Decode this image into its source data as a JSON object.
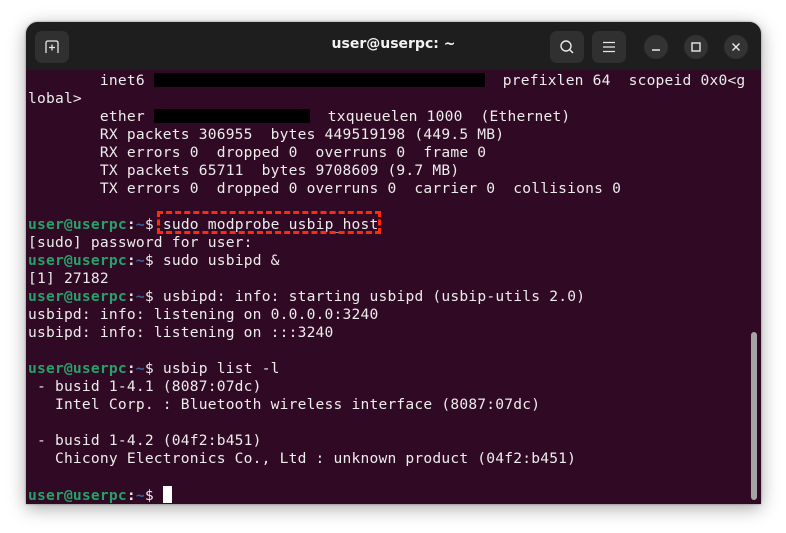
{
  "window": {
    "title": "user@userpc: ~",
    "buttons": {
      "new_tab_icon": "new-tab-icon",
      "search_icon": "search-icon",
      "menu_icon": "hamburger-menu-icon",
      "minimize_icon": "minimize-icon",
      "maximize_icon": "maximize-icon",
      "close_icon": "close-icon"
    }
  },
  "prompt": {
    "user_host": "user@userpc",
    "colon": ":",
    "path": "~",
    "symbol": "$ "
  },
  "terminal": {
    "lines": [
      {
        "type": "redacted",
        "pre": "        inet6 ",
        "post": "  prefixlen 64  scopeid 0x0<g"
      },
      {
        "type": "output",
        "text": "lobal>"
      },
      {
        "type": "redacted2",
        "pre": "        ether ",
        "post": "  txqueuelen 1000  (Ethernet)"
      },
      {
        "type": "output",
        "text": "        RX packets 306955  bytes 449519198 (449.5 MB)"
      },
      {
        "type": "output",
        "text": "        RX errors 0  dropped 0  overruns 0  frame 0"
      },
      {
        "type": "output",
        "text": "        TX packets 65711  bytes 9708609 (9.7 MB)"
      },
      {
        "type": "output",
        "text": "        TX errors 0  dropped 0 overruns 0  carrier 0  collisions 0"
      },
      {
        "type": "output",
        "text": ""
      },
      {
        "type": "command",
        "text": "sudo modprobe usbip_host"
      },
      {
        "type": "output",
        "text": "[sudo] password for user:"
      },
      {
        "type": "command",
        "text": "sudo usbipd &"
      },
      {
        "type": "output",
        "text": "[1] 27182"
      },
      {
        "type": "command",
        "text": "usbipd: info: starting usbipd (usbip-utils 2.0)"
      },
      {
        "type": "output",
        "text": "usbipd: info: listening on 0.0.0.0:3240"
      },
      {
        "type": "output",
        "text": "usbipd: info: listening on :::3240"
      },
      {
        "type": "output",
        "text": ""
      },
      {
        "type": "command",
        "text": "usbip list -l"
      },
      {
        "type": "output",
        "text": " - busid 1-4.1 (8087:07dc)"
      },
      {
        "type": "output",
        "text": "   Intel Corp. : Bluetooth wireless interface (8087:07dc)"
      },
      {
        "type": "output",
        "text": ""
      },
      {
        "type": "output",
        "text": " - busid 1-4.2 (04f2:b451)"
      },
      {
        "type": "output",
        "text": "   Chicony Electronics Co., Ltd : unknown product (04f2:b451)"
      },
      {
        "type": "output",
        "text": ""
      },
      {
        "type": "current",
        "text": ""
      }
    ]
  },
  "annotation": {
    "highlighted_command": "sudo modprobe usbip_host",
    "color": "#ff2a0c"
  },
  "colors": {
    "terminal_bg": "#300a24",
    "titlebar_bg": "#1e1e1e",
    "prompt_user": "#26a269",
    "prompt_path": "#3465a4",
    "text": "#ececec"
  }
}
